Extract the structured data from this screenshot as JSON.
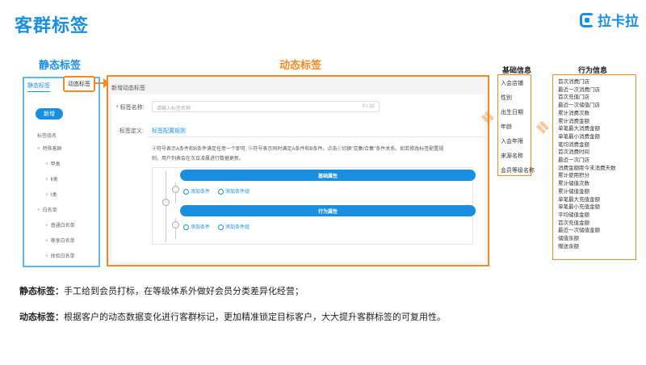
{
  "page_title": "客群标签",
  "logo_text": "拉卡拉",
  "sections": {
    "static_heading": "静态标签",
    "dynamic_heading": "动态标签",
    "basic_heading": "基础信息",
    "behavior_heading": "行为信息"
  },
  "static_panel": {
    "tab_label": "静态标签",
    "add_button": "新增",
    "list_header": "标签组名",
    "tree": [
      {
        "label": "特殊客群",
        "level": 0
      },
      {
        "label": "甲类",
        "level": 1
      },
      {
        "label": "Ⅱ类",
        "level": 1
      },
      {
        "label": "Ⅰ类",
        "level": 1
      },
      {
        "label": "白名单",
        "level": 0
      },
      {
        "label": "普通白名单",
        "level": 1
      },
      {
        "label": "尊享白名单",
        "level": 1
      },
      {
        "label": "体验白名单",
        "level": 1
      }
    ]
  },
  "dynamic_tab_label": "动态标签",
  "dynamic_panel": {
    "title": "新增动态标签",
    "name_label": "* 标签名称:",
    "name_placeholder": "请输入标签名称",
    "name_counter": "0 / 32",
    "definition_label": "标签定义:",
    "rule_tab": "标签配置规则",
    "description": "ⓐ符号表示A条件和B条件满足任意一个即可; ⓑ符号表示同时满足A条件和B条件。点击ⓒ切换\"交集/合集\"条件关系。如若修改标签配置规则，用户列表会在次日凌晨进行数据更新。",
    "groups": [
      {
        "title": "基础属性",
        "add_condition": "添加条件",
        "add_group": "添加条件组"
      },
      {
        "title": "行为属性",
        "add_condition": "添加条件",
        "add_group": "添加条件组"
      }
    ]
  },
  "basic_info": [
    "入会店铺",
    "性别",
    "出生日期",
    "年龄",
    "入会年限",
    "来源名称",
    "会员等级名称"
  ],
  "behavior_info": [
    "首次消费门店",
    "最近一次消费门店",
    "首次充值门店",
    "最近一次储值门店",
    "累计消费次数",
    "累计消费金额",
    "单笔最大消费金额",
    "单笔最小消费金额",
    "笔均消费金额",
    "首次消费时间",
    "最近一次门店",
    "消费金额距今末消费天数",
    "累计使用积分",
    "累计储值次数",
    "累计储值金额",
    "单笔最大充值金额",
    "单笔最小充值金额",
    "平均储值金额",
    "首次充值金额",
    "最近一次储值金额",
    "储值余额",
    "赠送余额"
  ],
  "footer": {
    "static_term": "静态标签：",
    "static_text": "手工给到会员打标，在等级体系外做好会员分类差异化经营；",
    "dynamic_term": "动态标签：",
    "dynamic_text": "根据客户的动态数据变化进行客群标记，更加精准锁定目标客户，大大提升客群标签的可复用性。"
  },
  "colors": {
    "accent": "#1a8fe0",
    "highlight": "#f08a24"
  }
}
